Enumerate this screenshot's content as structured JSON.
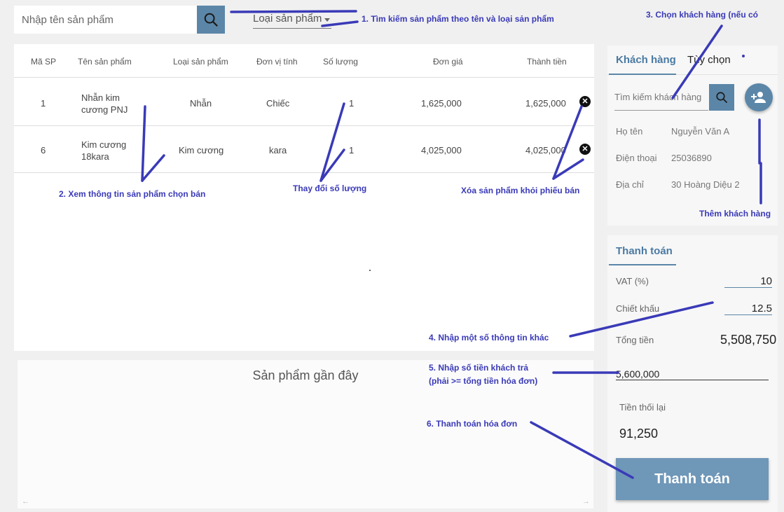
{
  "search": {
    "placeholder": "Nhập tên sản phẩm"
  },
  "category_select": {
    "value": "Loại sản phẩm"
  },
  "table": {
    "headers": [
      "Mã SP",
      "Tên sản phẩm",
      "Loại sản phẩm",
      "Đơn vị tính",
      "Số lượng",
      "Đơn giá",
      "Thành tiền"
    ],
    "rows": [
      {
        "code": "1",
        "name": "Nhẫn kim cương PNJ",
        "type": "Nhẫn",
        "unit": "Chiếc",
        "qty": "1",
        "price": "1,625,000",
        "total": "1,625,000"
      },
      {
        "code": "6",
        "name": "Kim cương 18kara",
        "type": "Kim cương",
        "unit": "kara",
        "qty": "1",
        "price": "4,025,000",
        "total": "4,025,000"
      }
    ],
    "delete_glyph": "✕"
  },
  "recent": {
    "title": "Sản phẩm gần đây",
    "left_arrow": "←",
    "right_arrow": "→"
  },
  "customer": {
    "tabs": [
      "Khách hàng",
      "Tùy chọn"
    ],
    "search_placeholder": "Tìm kiếm khách hàng",
    "fields": [
      {
        "label": "Họ tên",
        "value": "Nguyễn Văn A"
      },
      {
        "label": "Điện thoại",
        "value": "25036890"
      },
      {
        "label": "Địa chỉ",
        "value": "30 Hoàng Diệu 2"
      }
    ]
  },
  "payment": {
    "tab": "Thanh toán",
    "vat_label": "VAT (%)",
    "vat_value": "10",
    "discount_label": "Chiết khấu",
    "discount_value": "12.5",
    "total_label": "Tổng tiền",
    "total_value": "5,508,750",
    "paid_value": "5,600,000",
    "change_label": "Tiền thối lại",
    "change_value": "91,250",
    "button": "Thanh toán"
  },
  "annotations": {
    "a1": "1. Tìm kiếm sản phẩm theo tên và loại sản phẩm",
    "a2": "2. Xem thông tin sản phẩm chọn bán",
    "a3": "3. Chọn khách hàng (nếu có",
    "a4": "4. Nhập một số thông tin khác",
    "a5_line1": "5. Nhập số tiền khách trả",
    "a5_line2": "(phải >= tổng tiền hóa đơn)",
    "a6": "6. Thanh toán hóa đơn",
    "qty": "Thay đổi số lượng",
    "delete": "Xóa sản phẩm khỏi phiếu bán",
    "add_customer": "Thêm khách hàng"
  },
  "icons": {
    "search": "search-icon",
    "add_user": "add-user-icon",
    "delete": "close-circle-icon"
  },
  "colors": {
    "accent": "#5b86a8",
    "annotation": "#3a3ab8"
  }
}
